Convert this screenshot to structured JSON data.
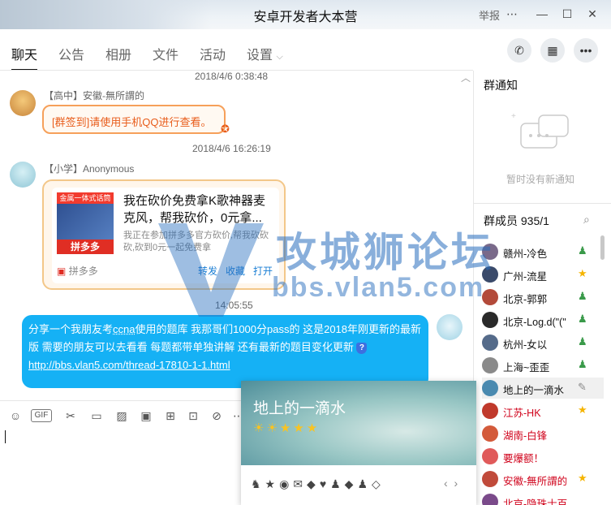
{
  "window": {
    "title": "安卓开发者大本营",
    "report_label": "举报"
  },
  "tabs": [
    {
      "label": "聊天"
    },
    {
      "label": "公告"
    },
    {
      "label": "相册"
    },
    {
      "label": "文件"
    },
    {
      "label": "活动"
    },
    {
      "label": "设置"
    }
  ],
  "chat": {
    "messages": [
      {
        "timestamp": "2018/4/6 0:38:48",
        "sender": "【高中】安徽-無所謂的",
        "text": "[群签到]请使用手机QQ进行查看。"
      },
      {
        "timestamp": "2018/4/6 16:26:19",
        "sender": "【小学】Anonymous",
        "card": {
          "thumb_tag": "金属一体式话筒",
          "thumb_brand": "拼多多",
          "title": "我在砍价免费拿K歌神器麦克风，帮我砍价，0元拿...",
          "desc": "我正在参加拼多多官方砍价,帮我砍砍砍,砍到0元一起免费拿",
          "source": "拼多多",
          "actions": [
            "转发",
            "收藏",
            "打开"
          ]
        }
      },
      {
        "timestamp": "14:05:55",
        "text_before": "分享一个我朋友考",
        "text_u": "ccna",
        "text_after": "使用的题库 我那哥们1000分pass的 这是2018年刚更新的最新版 需要的朋友可以去看看 每题都带单独讲解 还有最新的题目变化更新",
        "link": "http://bbs.vlan5.com/thread-17810-1-1.html"
      }
    ]
  },
  "right_panel": {
    "notice_title": "群通知",
    "notice_empty": "暂时没有新通知",
    "members_title": "群成员 935/1",
    "members": [
      {
        "name": "赣州-冷色",
        "color": "#7a6a8a"
      },
      {
        "name": "广州-流星",
        "color": "#3a4a6a"
      },
      {
        "name": "北京-郭郭",
        "color": "#b34a3a"
      },
      {
        "name": "北京-Log.d(\"(\"",
        "color": "#2a2a2a"
      },
      {
        "name": "杭州-女以",
        "color": "#556b8a"
      },
      {
        "name": "上海~歪歪",
        "color": "#8a8a8a"
      },
      {
        "name": "地上的一滴水",
        "color": "#4a8ab0"
      },
      {
        "name": "江苏-HK",
        "color": "#c0392b",
        "red": true
      },
      {
        "name": "湖南-白锋",
        "color": "#d35a3a",
        "red": true
      },
      {
        "name": "要爆额！",
        "color": "#e05a5a",
        "red": true
      },
      {
        "name": "安徽-無所謂的",
        "color": "#c04a3a",
        "red": true
      },
      {
        "name": "北京-隐珠士百",
        "color": "#7a4a8a",
        "red": true
      }
    ]
  },
  "popup": {
    "name": "地上的一滴水",
    "level_icons": "☀☀★★★",
    "medals": "♞★◉✉◆♥♟◆♟◇"
  },
  "watermark": {
    "logo_text": "攻城狮论坛",
    "url": "bbs.vlan5.com"
  },
  "colors": {
    "accent": "#15b1f5",
    "orange": "#f6a05a",
    "red_name": "#d0021b"
  }
}
